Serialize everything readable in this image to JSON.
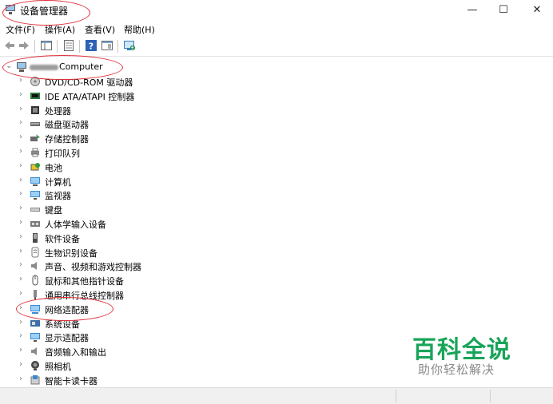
{
  "window": {
    "title": "设备管理器",
    "controls": {
      "minimize": "—",
      "maximize": "☐",
      "close": "✕"
    }
  },
  "menu": [
    "文件(F)",
    "操作(A)",
    "查看(V)",
    "帮助(H)"
  ],
  "tree": {
    "root_label": "Computer",
    "items": [
      {
        "label": "DVD/CD-ROM 驱动器",
        "icon": "dvd-drive-icon"
      },
      {
        "label": "IDE ATA/ATAPI 控制器",
        "icon": "ide-controller-icon"
      },
      {
        "label": "处理器",
        "icon": "processor-icon"
      },
      {
        "label": "磁盘驱动器",
        "icon": "disk-drive-icon"
      },
      {
        "label": "存储控制器",
        "icon": "storage-controller-icon"
      },
      {
        "label": "打印队列",
        "icon": "printer-icon"
      },
      {
        "label": "电池",
        "icon": "battery-icon"
      },
      {
        "label": "计算机",
        "icon": "computer-icon"
      },
      {
        "label": "监视器",
        "icon": "monitor-icon"
      },
      {
        "label": "键盘",
        "icon": "keyboard-icon"
      },
      {
        "label": "人体学输入设备",
        "icon": "hid-icon"
      },
      {
        "label": "软件设备",
        "icon": "software-device-icon"
      },
      {
        "label": "生物识别设备",
        "icon": "biometric-icon"
      },
      {
        "label": "声音、视频和游戏控制器",
        "icon": "speaker-icon"
      },
      {
        "label": "鼠标和其他指针设备",
        "icon": "mouse-icon"
      },
      {
        "label": "通用串行总线控制器",
        "icon": "usb-icon"
      },
      {
        "label": "网络适配器",
        "icon": "network-adapter-icon"
      },
      {
        "label": "系统设备",
        "icon": "system-device-icon"
      },
      {
        "label": "显示适配器",
        "icon": "display-adapter-icon"
      },
      {
        "label": "音频输入和输出",
        "icon": "audio-io-icon"
      },
      {
        "label": "照相机",
        "icon": "camera-icon"
      },
      {
        "label": "智能卡读卡器",
        "icon": "smart-card-reader-icon"
      }
    ]
  },
  "watermark": {
    "main": "百科全说",
    "sub": "助你轻松解决",
    "color": "#19a45a"
  },
  "annotation_color": "#e0313a"
}
